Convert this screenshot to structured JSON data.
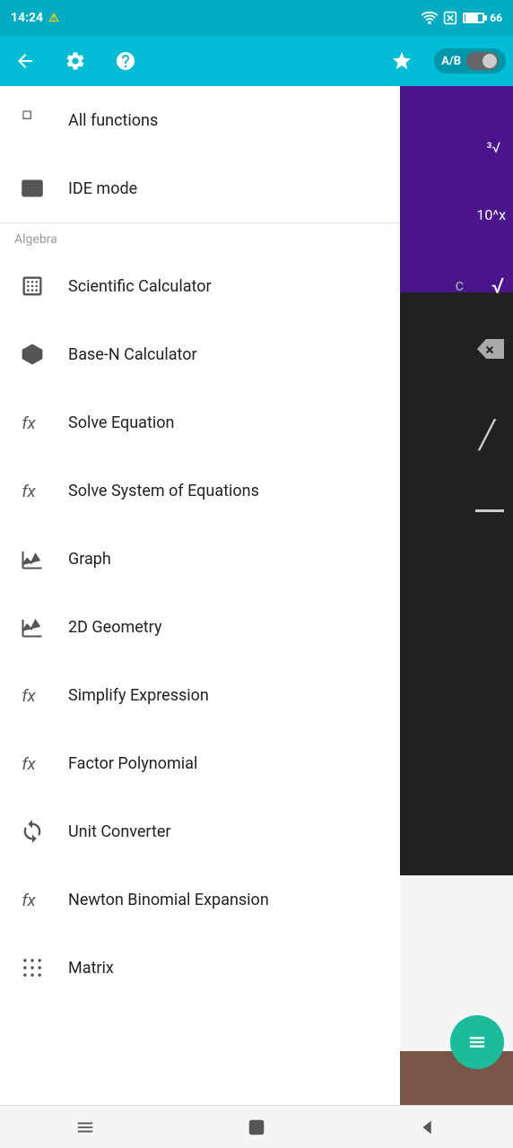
{
  "statusBar": {
    "time": "14:24",
    "warning": "⚠",
    "batteryPercent": "66"
  },
  "toolbar": {
    "abLabel": "A/B",
    "backIcon": "back-arrow-icon",
    "settingsIcon": "gear-icon",
    "helpIcon": "help-icon",
    "starIcon": "star-icon"
  },
  "menu": {
    "allFunctionsLabel": "All functions",
    "ideModeLabel": "IDE mode",
    "algebraSection": "Algebra",
    "items": [
      {
        "id": "scientific-calculator",
        "label": "Scientific Calculator",
        "icon": "calculator-icon"
      },
      {
        "id": "base-n-calculator",
        "label": "Base-N Calculator",
        "icon": "hexagon-icon"
      },
      {
        "id": "solve-equation",
        "label": "Solve Equation",
        "icon": "fx-icon"
      },
      {
        "id": "solve-system",
        "label": "Solve System of Equations",
        "icon": "fx-icon"
      },
      {
        "id": "graph",
        "label": "Graph",
        "icon": "graph-icon"
      },
      {
        "id": "2d-geometry",
        "label": "2D Geometry",
        "icon": "graph-icon"
      },
      {
        "id": "simplify-expression",
        "label": "Simplify Expression",
        "icon": "fx-icon"
      },
      {
        "id": "factor-polynomial",
        "label": "Factor Polynomial",
        "icon": "fx-icon"
      },
      {
        "id": "unit-converter",
        "label": "Unit Converter",
        "icon": "unit-converter-icon"
      },
      {
        "id": "newton-binomial",
        "label": "Newton Binomial Expansion",
        "icon": "fx-icon"
      },
      {
        "id": "matrix",
        "label": "Matrix",
        "icon": "matrix-icon"
      }
    ]
  },
  "bottomNav": {
    "menuIcon": "hamburger-icon",
    "homeIcon": "home-square-icon",
    "backIcon": "back-triangle-icon"
  }
}
